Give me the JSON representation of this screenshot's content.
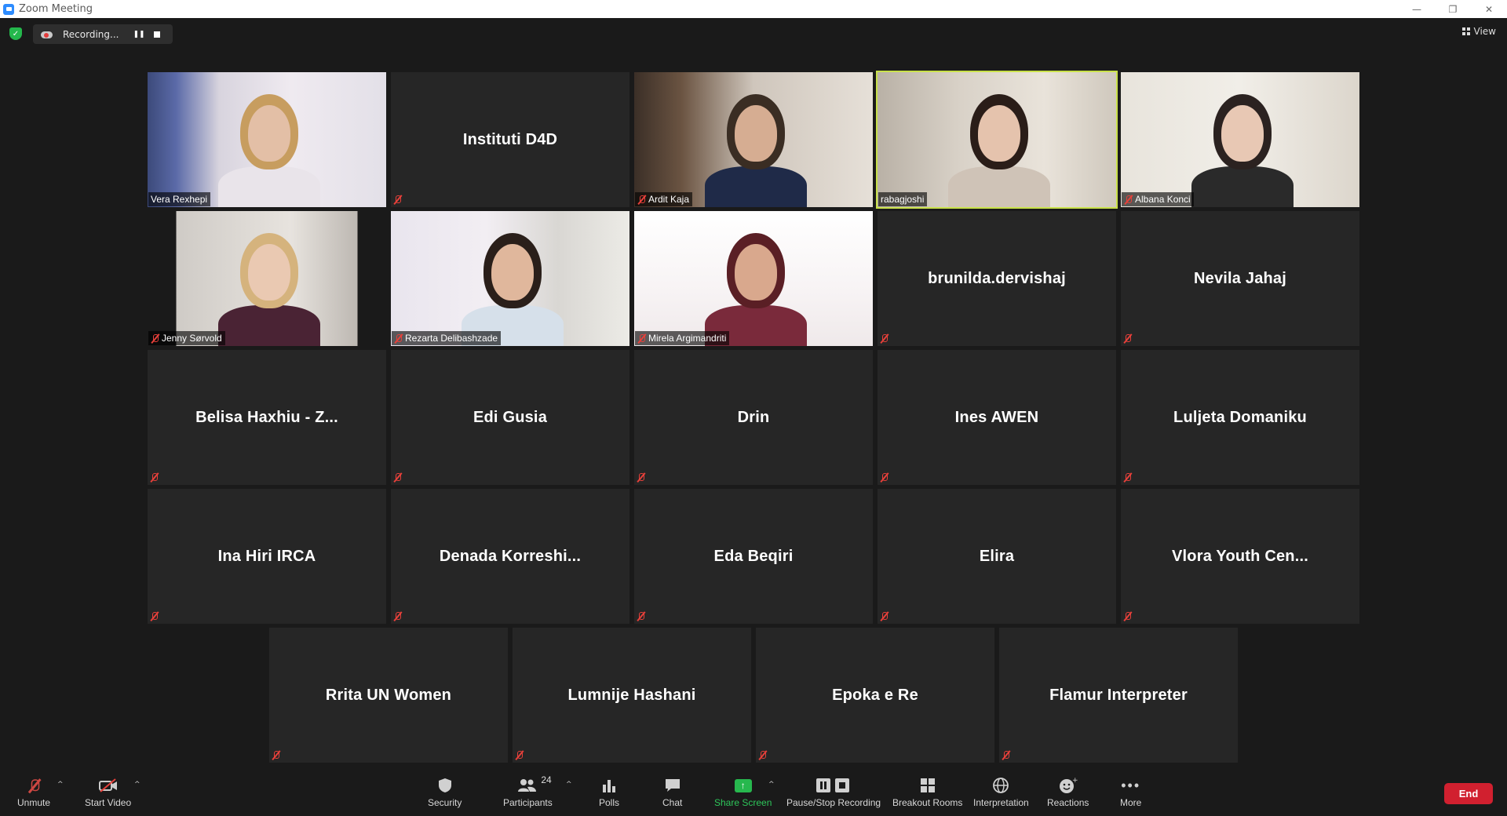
{
  "window": {
    "title": "Zoom Meeting",
    "minimize": "—",
    "restore": "❐",
    "close": "✕"
  },
  "topbar": {
    "recording_text": "Recording...",
    "pause_icon": "❚❚",
    "view_label": "View"
  },
  "tiles": [
    {
      "name": "Vera Rexhepi",
      "video": true
    },
    {
      "name": "Instituti D4D",
      "video": false
    },
    {
      "name": "Ardit Kaja",
      "video": true
    },
    {
      "name": "rabagjoshi",
      "video": true,
      "active": true
    },
    {
      "name": "Albana Konci",
      "video": true
    },
    {
      "name": "Jenny Sørvold",
      "video": true
    },
    {
      "name": "Rezarta Delibashzade",
      "video": true
    },
    {
      "name": "Mirela Argimandriti",
      "video": true
    },
    {
      "name": "brunilda.dervishaj",
      "video": false
    },
    {
      "name": "Nevila Jahaj",
      "video": false
    },
    {
      "name": "Belisa Haxhiu - Z...",
      "video": false
    },
    {
      "name": "Edi Gusia",
      "video": false
    },
    {
      "name": "Drin",
      "video": false
    },
    {
      "name": "Ines AWEN",
      "video": false
    },
    {
      "name": "Luljeta Domaniku",
      "video": false
    },
    {
      "name": "Ina Hiri IRCA",
      "video": false
    },
    {
      "name": "Denada  Korreshi...",
      "video": false
    },
    {
      "name": "Eda Beqiri",
      "video": false
    },
    {
      "name": "Elira",
      "video": false
    },
    {
      "name": "Vlora  Youth Cen...",
      "video": false
    },
    {
      "name": "Rrita UN Women",
      "video": false
    },
    {
      "name": "Lumnije Hashani",
      "video": false
    },
    {
      "name": "Epoka e Re",
      "video": false
    },
    {
      "name": "Flamur Interpreter",
      "video": false
    }
  ],
  "toolbar": {
    "unmute": "Unmute",
    "start_video": "Start Video",
    "security": "Security",
    "participants": "Participants",
    "participants_count": "24",
    "polls": "Polls",
    "chat": "Chat",
    "share_screen": "Share Screen",
    "pause_stop_recording": "Pause/Stop Recording",
    "breakout_rooms": "Breakout Rooms",
    "interpretation": "Interpretation",
    "reactions": "Reactions",
    "more": "More",
    "end": "End",
    "caret": "^"
  },
  "colors": {
    "active_speaker": "#c9e14a",
    "end_button": "#d1202f",
    "share_green": "#27b84e",
    "muted_red": "#e8403a"
  }
}
